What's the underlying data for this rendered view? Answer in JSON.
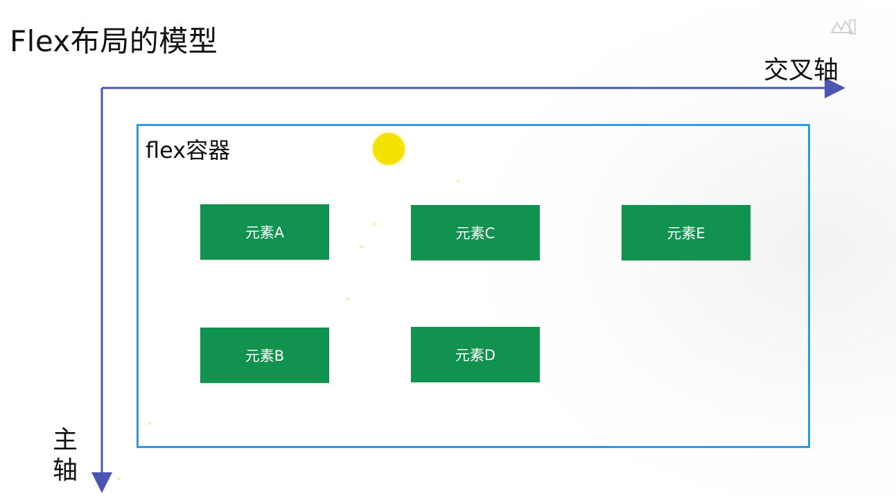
{
  "title": "Flex布局的模型",
  "axes": {
    "cross_axis_label": "交叉轴",
    "main_axis_label_line1": "主",
    "main_axis_label_line2": "轴"
  },
  "container": {
    "label": "flex容器"
  },
  "items": {
    "a": "元素A",
    "b": "元素B",
    "c": "元素C",
    "d": "元素D",
    "e": "元素E"
  },
  "colors": {
    "axis": "#4a56b0",
    "container_border": "#2f9be8",
    "item_fill": "#12924f",
    "item_text": "#ffffff",
    "pointer": "#f4e100"
  },
  "icons": {
    "watermark": "watermark-logo-icon",
    "pointer": "cursor-highlight-icon"
  }
}
